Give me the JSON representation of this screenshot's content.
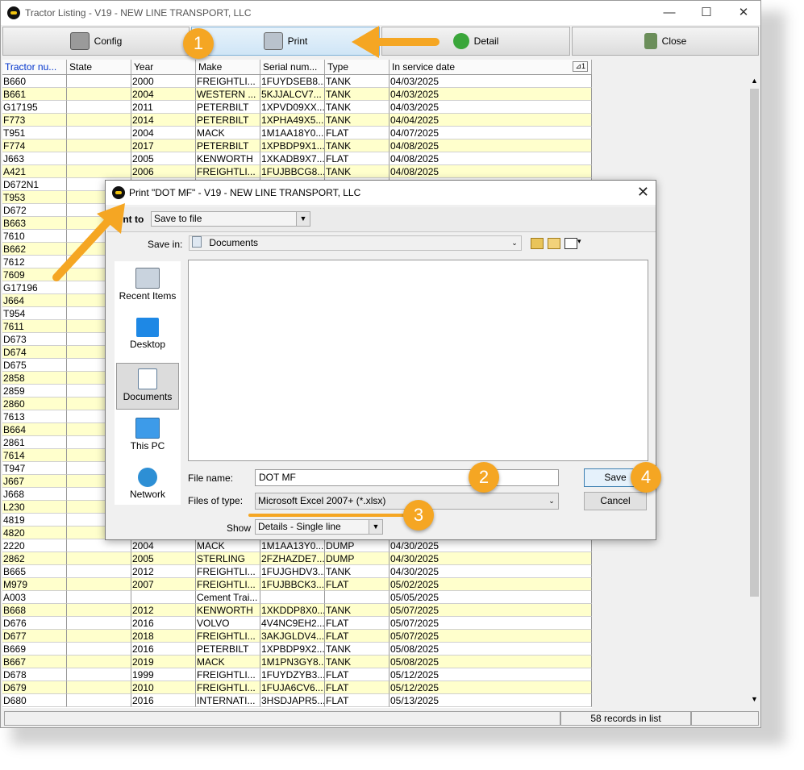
{
  "window": {
    "title": "Tractor Listing - V19 - NEW LINE TRANSPORT, LLC",
    "min": "—",
    "max": "☐",
    "close": "✕"
  },
  "toolbar": {
    "config": "Config",
    "print": "Print",
    "detail": "Detail",
    "close": "Close"
  },
  "grid": {
    "columns": [
      "Tractor nu...",
      "State",
      "Year",
      "Make",
      "Serial num...",
      "Type",
      "In service date"
    ],
    "sort_indicator": "1",
    "rows": [
      [
        "B660",
        "",
        "2000",
        "FREIGHTLI...",
        "1FUYDSEB8...",
        "TANK",
        "04/03/2025"
      ],
      [
        "B661",
        "",
        "2004",
        "WESTERN ...",
        "5KJJALCV7...",
        "TANK",
        "04/03/2025"
      ],
      [
        "G17195",
        "",
        "2011",
        "PETERBILT",
        "1XPVD09XX...",
        "TANK",
        "04/03/2025"
      ],
      [
        "F773",
        "",
        "2014",
        "PETERBILT",
        "1XPHA49X5...",
        "TANK",
        "04/04/2025"
      ],
      [
        "T951",
        "",
        "2004",
        "MACK",
        "1M1AA18Y0...",
        "FLAT",
        "04/07/2025"
      ],
      [
        "F774",
        "",
        "2017",
        "PETERBILT",
        "1XPBDP9X1...",
        "TANK",
        "04/08/2025"
      ],
      [
        "J663",
        "",
        "2005",
        "KENWORTH",
        "1XKADB9X7...",
        "FLAT",
        "04/08/2025"
      ],
      [
        "A421",
        "",
        "2006",
        "FREIGHTLI...",
        "1FUJBBCG8...",
        "TANK",
        "04/08/2025"
      ],
      [
        "D672N1",
        "",
        "",
        "",
        "",
        "",
        ""
      ],
      [
        "T953",
        "",
        "",
        "",
        "",
        "",
        ""
      ],
      [
        "D672",
        "",
        "",
        "",
        "",
        "",
        ""
      ],
      [
        "B663",
        "",
        "",
        "",
        "",
        "",
        ""
      ],
      [
        "7610",
        "",
        "",
        "",
        "",
        "",
        ""
      ],
      [
        "B662",
        "",
        "",
        "",
        "",
        "",
        ""
      ],
      [
        "7612",
        "",
        "",
        "",
        "",
        "",
        ""
      ],
      [
        "7609",
        "",
        "",
        "",
        "",
        "",
        ""
      ],
      [
        "G17196",
        "",
        "",
        "",
        "",
        "",
        ""
      ],
      [
        "J664",
        "",
        "",
        "",
        "",
        "",
        ""
      ],
      [
        "T954",
        "",
        "",
        "",
        "",
        "",
        ""
      ],
      [
        "7611",
        "",
        "",
        "",
        "",
        "",
        ""
      ],
      [
        "D673",
        "",
        "",
        "",
        "",
        "",
        ""
      ],
      [
        "D674",
        "",
        "",
        "",
        "",
        "",
        ""
      ],
      [
        "D675",
        "",
        "",
        "",
        "",
        "",
        ""
      ],
      [
        "2858",
        "",
        "",
        "",
        "",
        "",
        ""
      ],
      [
        "2859",
        "",
        "",
        "",
        "",
        "",
        ""
      ],
      [
        "2860",
        "",
        "",
        "",
        "",
        "",
        ""
      ],
      [
        "7613",
        "",
        "",
        "",
        "",
        "",
        ""
      ],
      [
        "B664",
        "",
        "",
        "",
        "",
        "",
        ""
      ],
      [
        "2861",
        "",
        "",
        "",
        "",
        "",
        ""
      ],
      [
        "7614",
        "",
        "",
        "",
        "",
        "",
        ""
      ],
      [
        "T947",
        "",
        "",
        "",
        "",
        "",
        ""
      ],
      [
        "J667",
        "",
        "",
        "",
        "",
        "",
        ""
      ],
      [
        "J668",
        "",
        "",
        "",
        "",
        "",
        ""
      ],
      [
        "L230",
        "",
        "",
        "",
        "",
        "",
        ""
      ],
      [
        "4819",
        "",
        "",
        "",
        "",
        "",
        ""
      ],
      [
        "4820",
        "",
        "",
        "",
        "",
        "",
        ""
      ],
      [
        "2220",
        "",
        "2004",
        "MACK",
        "1M1AA13Y0...",
        "DUMP",
        "04/30/2025"
      ],
      [
        "2862",
        "",
        "2005",
        "STERLING",
        "2FZHAZDE7...",
        "DUMP",
        "04/30/2025"
      ],
      [
        "B665",
        "",
        "2012",
        "FREIGHTLI...",
        "1FUJGHDV3...",
        "TANK",
        "04/30/2025"
      ],
      [
        "M979",
        "",
        "2007",
        "FREIGHTLI...",
        "1FUJBBCK3...",
        "FLAT",
        "05/02/2025"
      ],
      [
        "A003",
        "",
        "",
        "Cement Trai...",
        "",
        "",
        "05/05/2025"
      ],
      [
        "B668",
        "",
        "2012",
        "KENWORTH",
        "1XKDDP8X0...",
        "TANK",
        "05/07/2025"
      ],
      [
        "D676",
        "",
        "2016",
        "VOLVO",
        "4V4NC9EH2...",
        "FLAT",
        "05/07/2025"
      ],
      [
        "D677",
        "",
        "2018",
        "FREIGHTLI...",
        "3AKJGLDV4...",
        "FLAT",
        "05/07/2025"
      ],
      [
        "B669",
        "",
        "2016",
        "PETERBILT",
        "1XPBDP9X2...",
        "TANK",
        "05/08/2025"
      ],
      [
        "B667",
        "",
        "2019",
        "MACK",
        "1M1PN3GY8...",
        "TANK",
        "05/08/2025"
      ],
      [
        "D678",
        "",
        "1999",
        "FREIGHTLI...",
        "1FUYDZYB3...",
        "FLAT",
        "05/12/2025"
      ],
      [
        "D679",
        "",
        "2010",
        "FREIGHTLI...",
        "1FUJA6CV6...",
        "FLAT",
        "05/12/2025"
      ],
      [
        "D680",
        "",
        "2016",
        "INTERNATI...",
        "3HSDJAPR5...",
        "FLAT",
        "05/13/2025"
      ]
    ]
  },
  "status": {
    "records": "58 records in list"
  },
  "dialog": {
    "title": "Print \"DOT MF\" - V19 - NEW LINE TRANSPORT, LLC",
    "close": "✕",
    "print_to_label": "int to",
    "print_to_value": "Save to file",
    "save_in_label": "Save in:",
    "save_in_value": "Documents",
    "places": [
      "Recent Items",
      "Desktop",
      "Documents",
      "This PC",
      "Network"
    ],
    "file_name_label": "File name:",
    "file_name_value": "DOT MF",
    "files_of_type_label": "Files of type:",
    "files_of_type_value": "Microsoft Excel 2007+ (*.xlsx)",
    "show_label": "Show",
    "show_value": "Details - Single line",
    "save": "Save",
    "cancel": "Cancel"
  },
  "annotations": {
    "b1": "1",
    "b2": "2",
    "b3": "3",
    "b4": "4",
    "color": "#f5a623"
  }
}
